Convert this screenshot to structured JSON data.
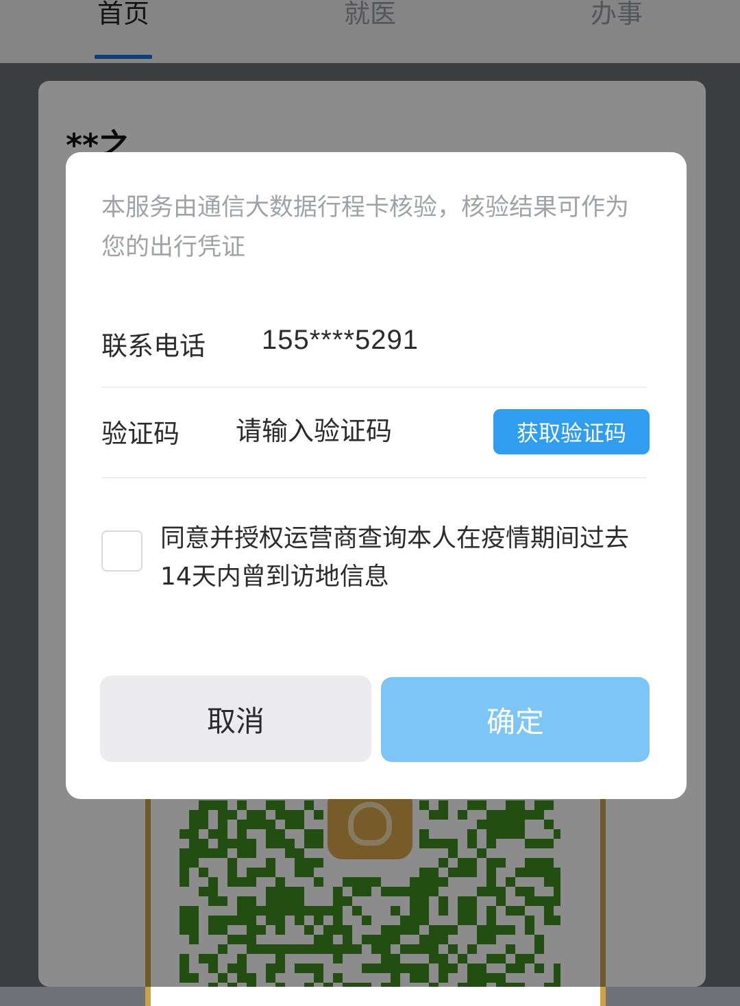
{
  "tabs": [
    {
      "label": "首页",
      "active": true
    },
    {
      "label": "就医",
      "active": false
    },
    {
      "label": "办事",
      "active": false
    }
  ],
  "background": {
    "user_name": "**之"
  },
  "dialog": {
    "notice": "本服务由通信大数据行程卡核验，核验结果可作为您的出行凭证",
    "phone_label": "联系电话",
    "phone_value": "155****5291",
    "code_label": "验证码",
    "code_placeholder": "请输入验证码",
    "get_code_button": "获取验证码",
    "agree_checked": false,
    "agree_text": "同意并授权运营商查询本人在疫情期间过去14天内曾到访地信息",
    "cancel_button": "取消",
    "confirm_button": "确定"
  },
  "colors": {
    "accent": "#2f9ef0",
    "confirm_disabled": "#7cc6f7",
    "tab_indicator": "#1f6fd6",
    "qr_color": "#3f8f1f"
  },
  "icons": [
    "qr-code-icon",
    "app-logo-icon"
  ]
}
